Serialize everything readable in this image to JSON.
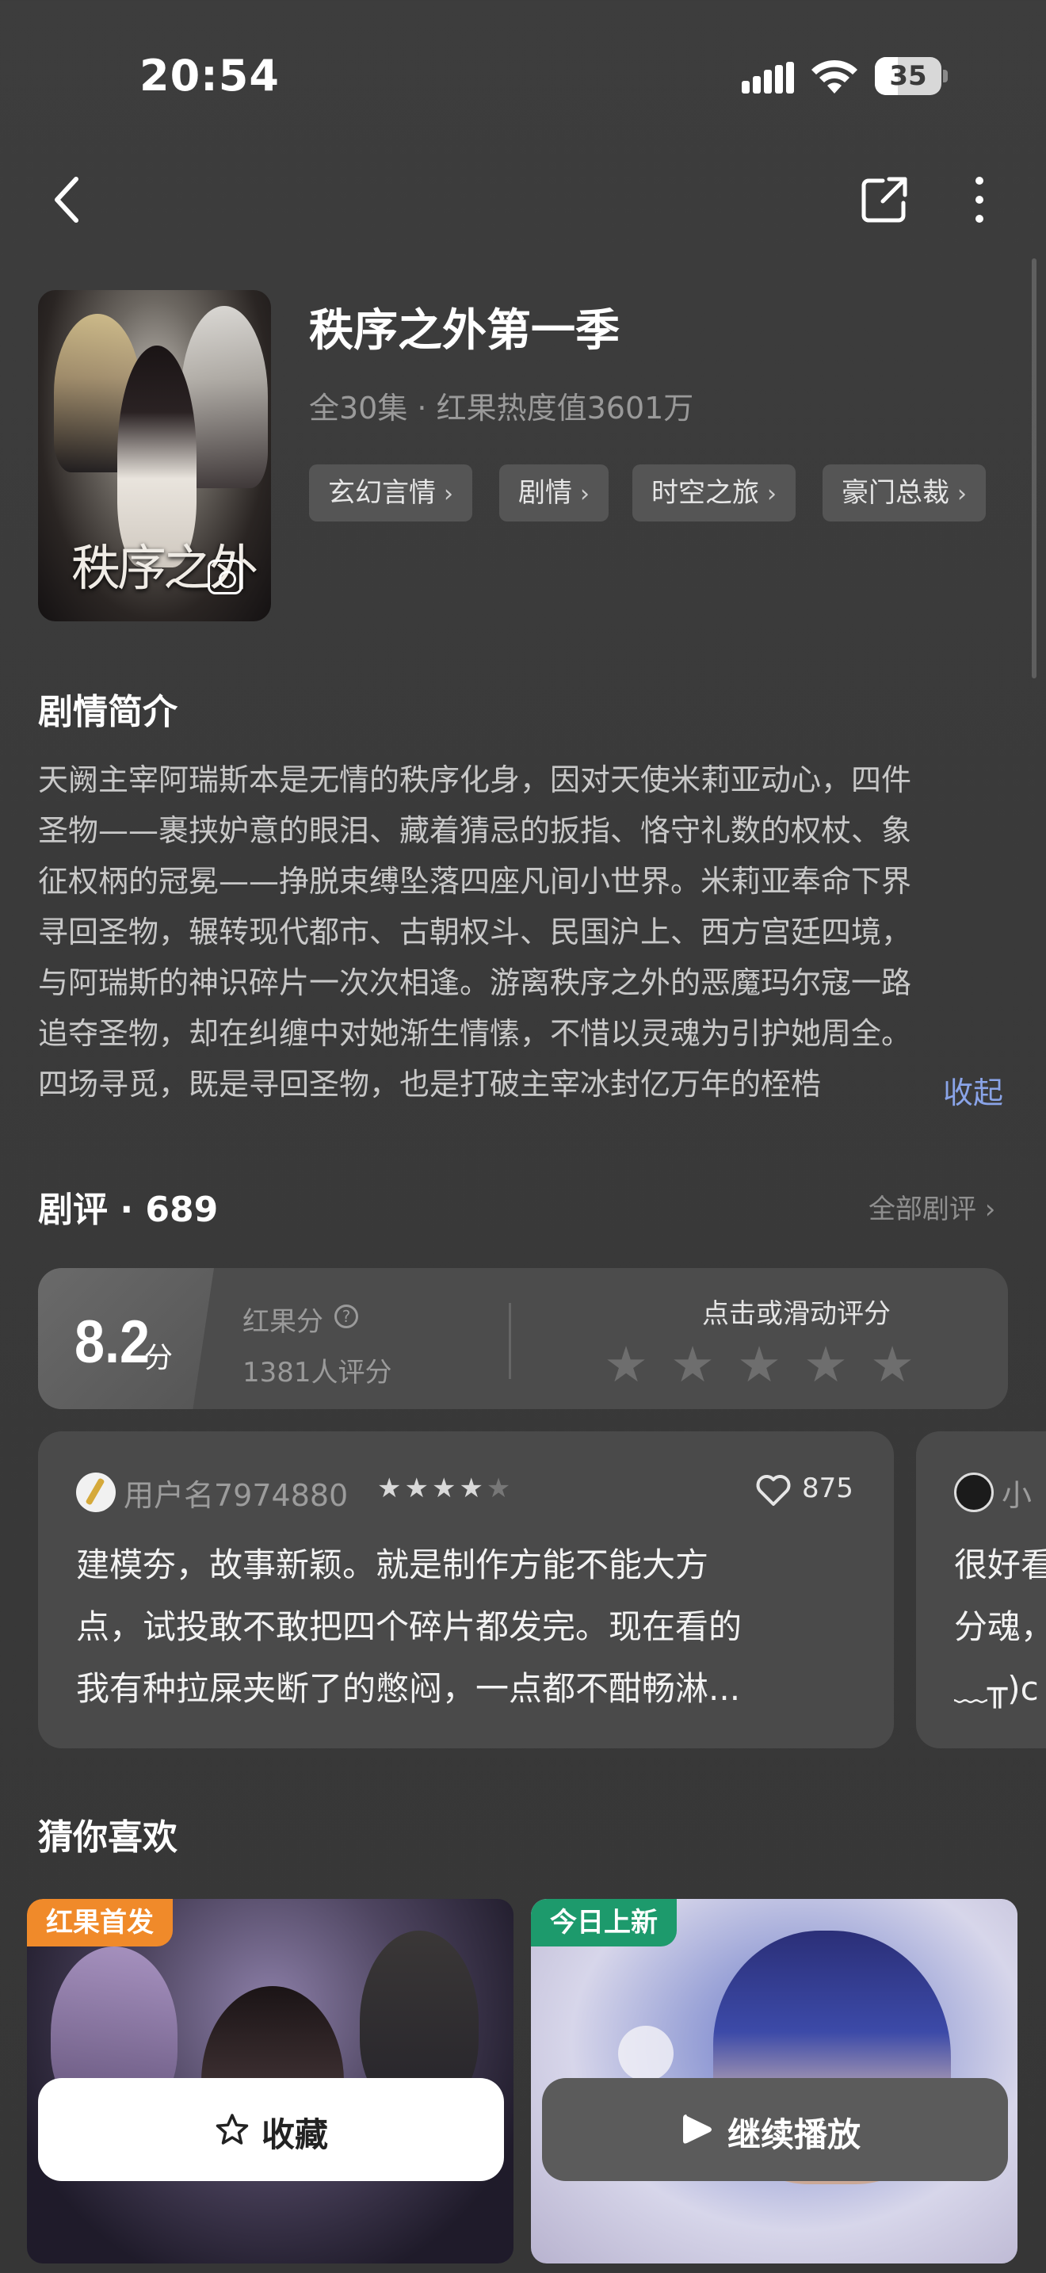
{
  "status_bar": {
    "time": "20:54",
    "battery_level": "35",
    "battery_fraction": 0.35
  },
  "nav": {
    "back_icon": "chevron-left-icon",
    "share_icon": "share-icon",
    "more_icon": "more-vertical-icon"
  },
  "show": {
    "poster_title": "秩序之外",
    "title": "秩序之外第一季",
    "meta": "全30集 · 红果热度值3601万",
    "tags": [
      "玄幻言情",
      "剧情",
      "时空之旅",
      "豪门总裁"
    ]
  },
  "synopsis": {
    "heading": "剧情简介",
    "lines": [
      "天阙主宰阿瑞斯本是无情的秩序化身，因对天使米莉亚动心，四件",
      "圣物——裹挟妒意的眼泪、藏着猜忌的扳指、恪守礼数的权杖、象",
      "征权柄的冠冕——挣脱束缚坠落四座凡间小世界。米莉亚奉命下界",
      "寻回圣物，辗转现代都市、古朝权斗、民国沪上、西方宫廷四境，",
      "与阿瑞斯的神识碎片一次次相逢。游离秩序之外的恶魔玛尔寇一路",
      "追夺圣物，却在纠缠中对她渐生情愫，不惜以灵魂为引护她周全。",
      "四场寻觅，既是寻回圣物，也是打破主宰冰封亿万年的桎梏"
    ],
    "collapse_label": "收起"
  },
  "reviews": {
    "heading": "剧评 · 689",
    "all_label": "全部剧评 ›",
    "score": "8.2",
    "score_unit": "分",
    "score_label": "红果分",
    "rating_count": "1381人评分",
    "rate_prompt": "点击或滑动评分",
    "rate_stars": 5,
    "items": [
      {
        "user": "用户名7974880",
        "stars": 4,
        "max_stars": 5,
        "likes": "875",
        "lines": [
          "建模夯，故事新颖。就是制作方能不能大方",
          "点，试投敢不敢把四个碎片都发完。现在看的",
          "我有种拉屎夹断了的憋闷，一点都不酣畅淋..."
        ]
      },
      {
        "user": "小",
        "lines": [
          "很好看",
          "分魂，",
          "﹏╥)c"
        ]
      }
    ]
  },
  "recommendations": {
    "heading": "猜你喜欢",
    "items": [
      {
        "badge": "红果首发",
        "badge_color": "#f08a2a"
      },
      {
        "badge": "今日上新",
        "badge_color": "#1d9a6c"
      }
    ]
  },
  "actions": {
    "favorite_label": "收藏",
    "play_label": "继续播放"
  }
}
